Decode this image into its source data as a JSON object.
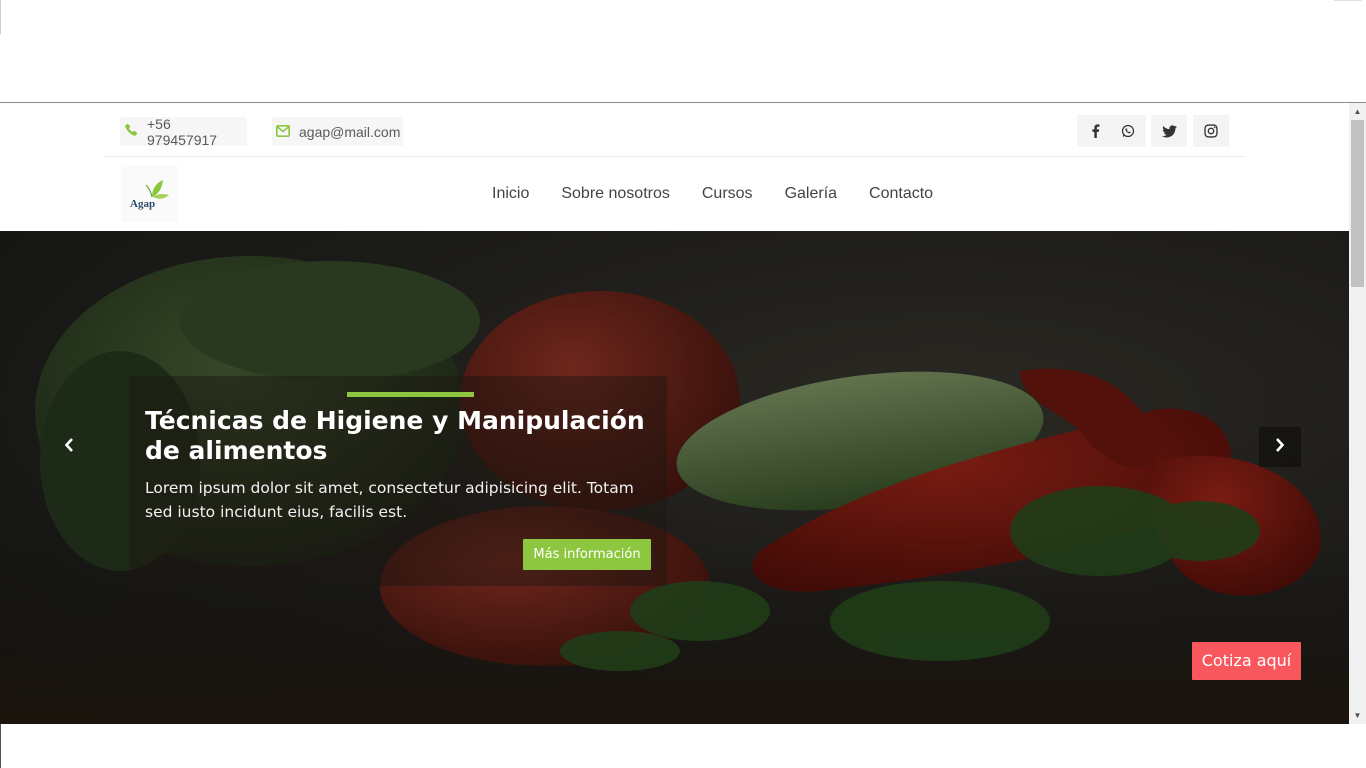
{
  "topbar": {
    "phone": "+56 979457917",
    "email": "agap@mail.com",
    "social_icons": [
      "facebook-icon",
      "whatsapp-icon",
      "twitter-icon",
      "instagram-icon"
    ]
  },
  "brand": {
    "logo_text": "Agap"
  },
  "nav": {
    "items": [
      "Inicio",
      "Sobre nosotros",
      "Cursos",
      "Galería",
      "Contacto"
    ]
  },
  "hero": {
    "title": "Técnicas de Higiene y Manipulación de alimentos",
    "text": "Lorem ipsum dolor sit amet, consectetur adipisicing elit. Totam sed iusto incidunt eius, facilis est.",
    "button_label": "Más información",
    "quote_button": "Cotiza aquí"
  },
  "colors": {
    "accent_green": "#8dc63f",
    "quote_red": "#f8575d",
    "icon_green": "#8dc63f"
  }
}
